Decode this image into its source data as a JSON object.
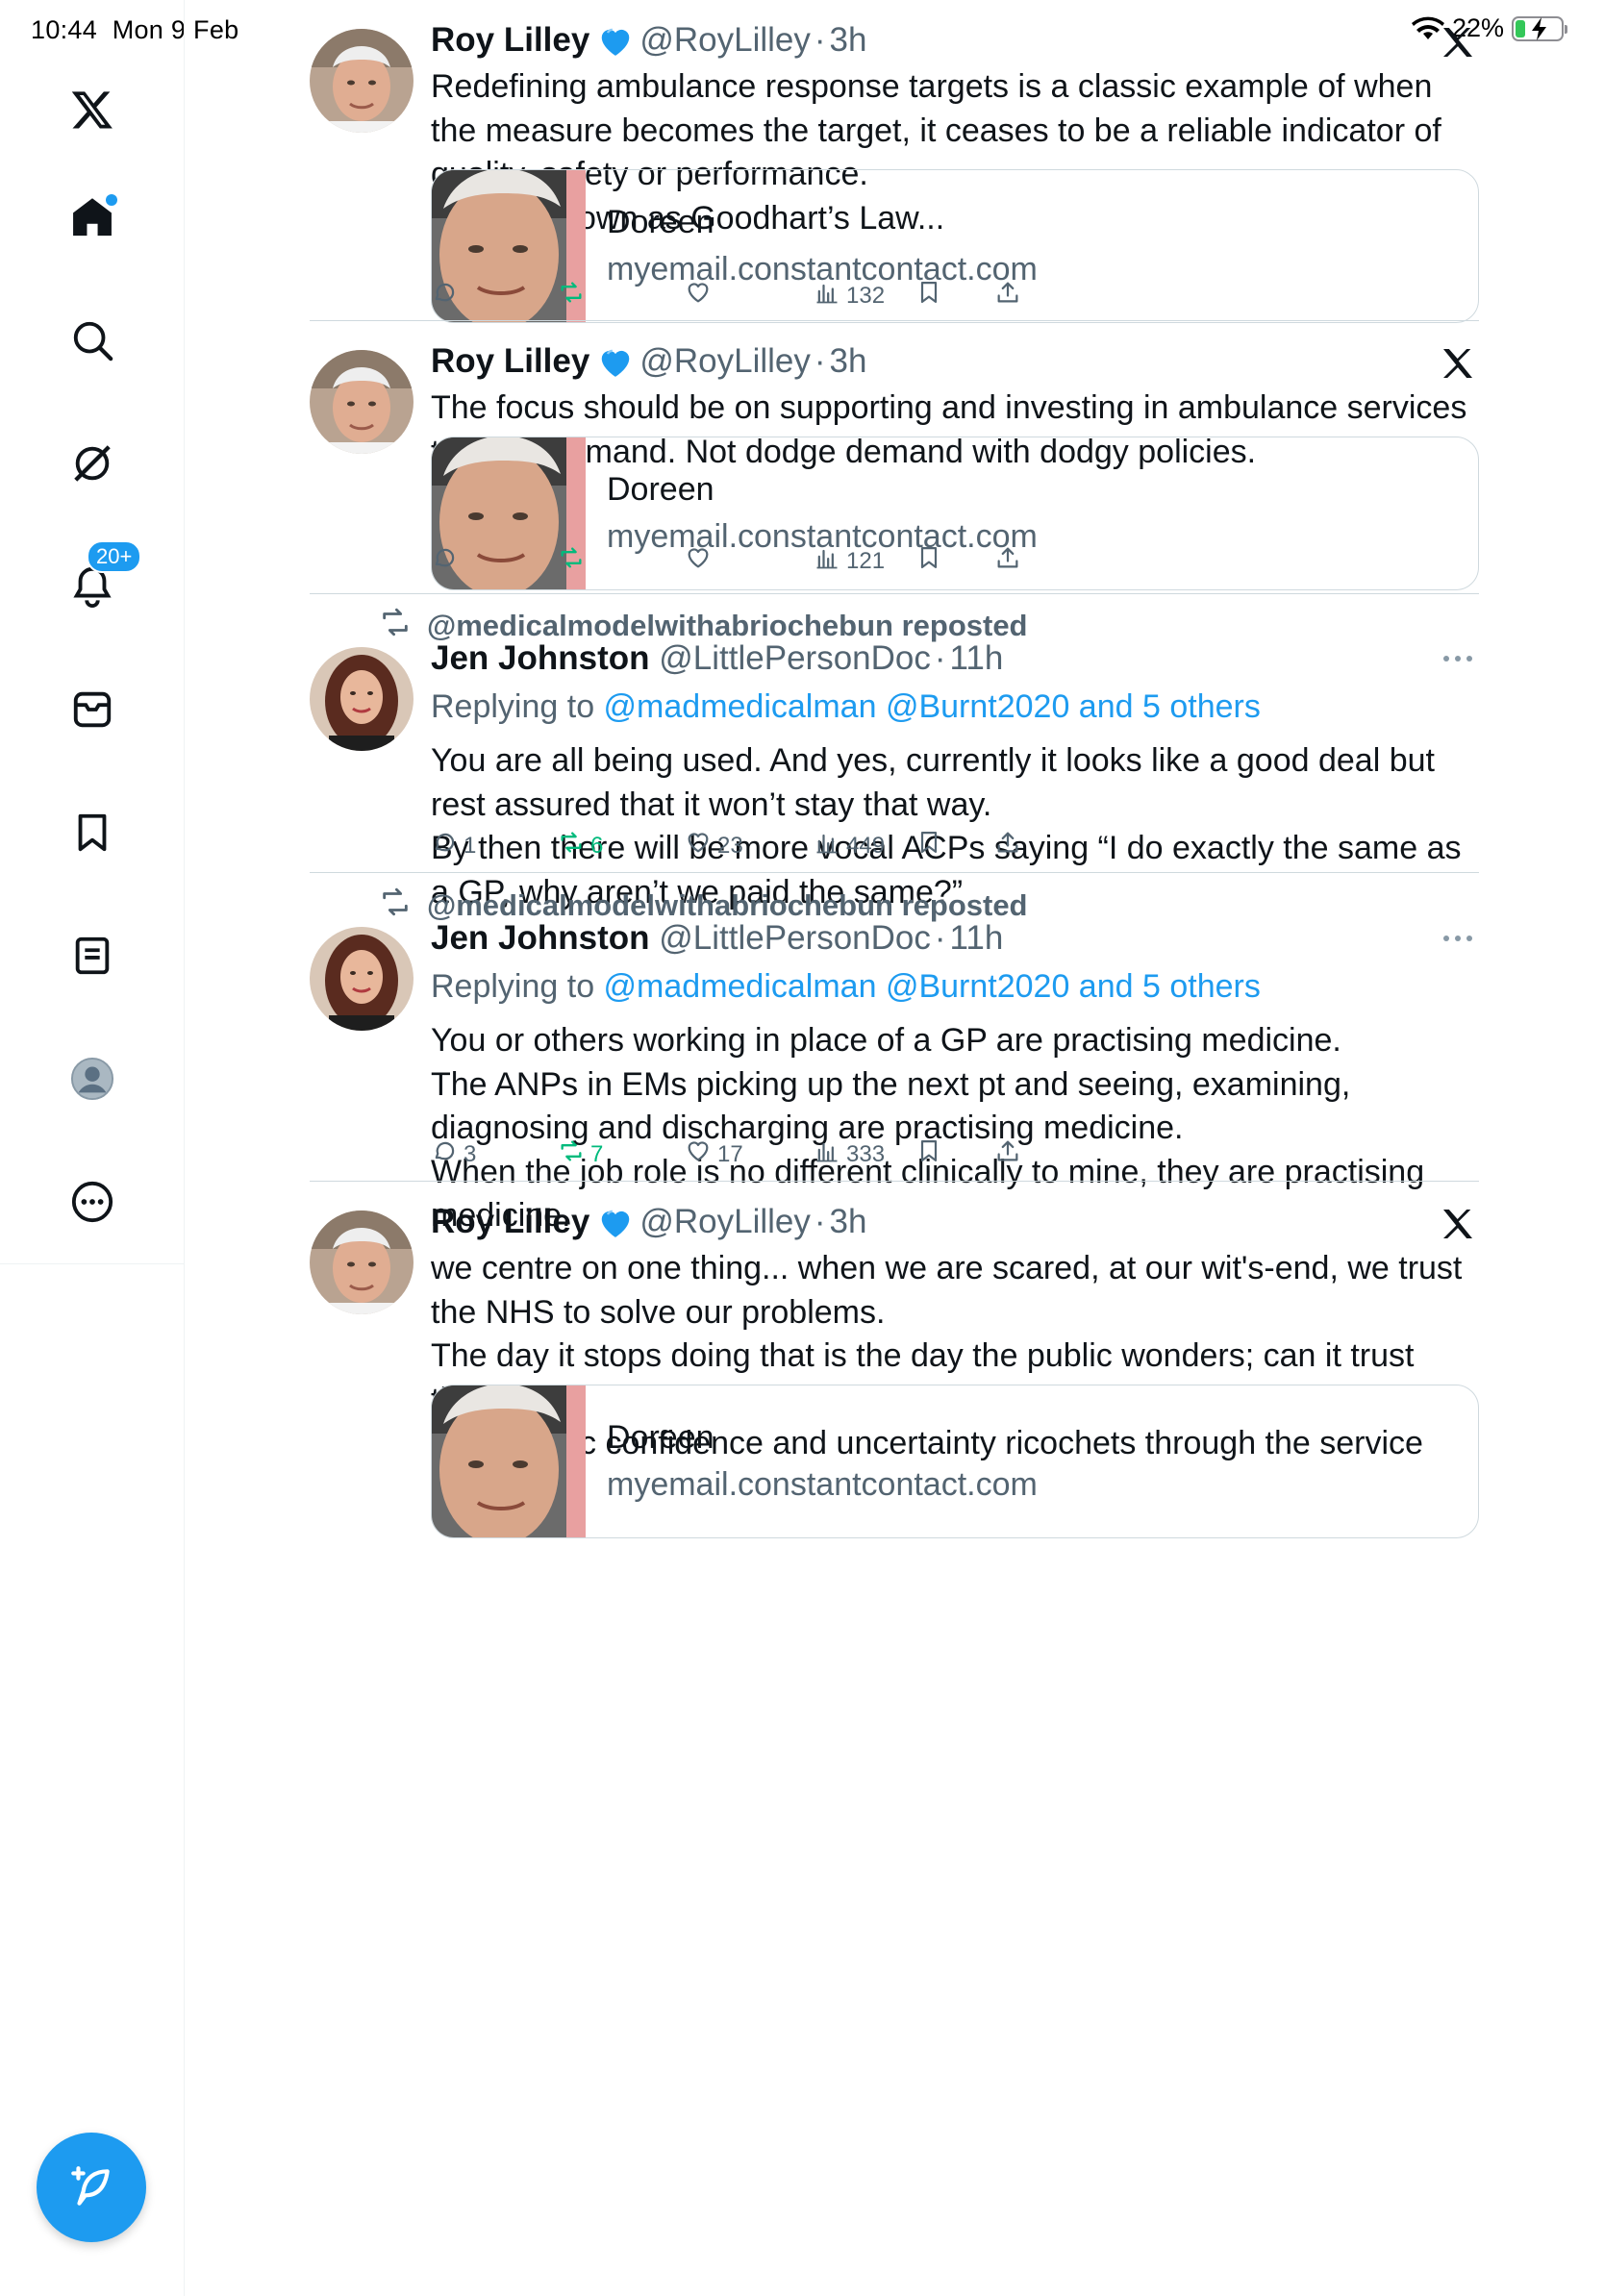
{
  "status_bar": {
    "time": "10:44",
    "date": "Mon 9 Feb",
    "battery_pct": "22%",
    "battery_level": 0.22
  },
  "sidebar": {
    "items": [
      {
        "name": "x-logo-icon"
      },
      {
        "name": "home-icon"
      },
      {
        "name": "search-icon"
      },
      {
        "name": "grok-icon"
      },
      {
        "name": "notifications-icon",
        "badge": "20+"
      },
      {
        "name": "messages-icon"
      },
      {
        "name": "bookmarks-icon"
      },
      {
        "name": "lists-icon"
      },
      {
        "name": "profile-icon"
      },
      {
        "name": "more-icon"
      }
    ],
    "compose_icon": "feather-plus-icon"
  },
  "colors": {
    "accent": "#1d9bf0",
    "retweet": "#00ba7c",
    "muted": "#536471"
  },
  "tweets": [
    {
      "name": "Roy Lilley",
      "handle": "@RoyLilley",
      "time": "3h",
      "text": "Redefining ambulance response targets is a classic example of when\nthe measure becomes the target, it ceases to be a reliable indicator of\nquality, safety or performance.\n This is known as Goodhart’s Law...",
      "card": {
        "title": "Doreen",
        "domain": "myemail.constantcontact.com"
      },
      "stats": {
        "replies": "",
        "reposts": "",
        "likes": "",
        "views": "132"
      }
    },
    {
      "name": "Roy Lilley",
      "handle": "@RoyLilley",
      "time": "3h",
      "text": "The focus should be on supporting and investing in ambulance services\nto meet demand. Not dodge demand with dodgy policies.",
      "card": {
        "title": "Doreen",
        "domain": "myemail.constantcontact.com"
      },
      "stats": {
        "replies": "",
        "reposts": "",
        "likes": "",
        "views": "121"
      }
    },
    {
      "reposted_by": "@medicalmodelwithabriochebun reposted",
      "name": "Jen Johnston",
      "handle": "@LittlePersonDoc",
      "time": "11h",
      "reply_prefix": "Replying to ",
      "reply_to": "@madmedicalman @Burnt2020 and 5 others",
      "text": "You are all being used. And yes, currently it looks like a good deal but\nrest assured that it won’t stay that way.\nBy then there will be more vocal ACPs saying “I do exactly the same as\na GP, why aren’t we paid the same?”",
      "stats": {
        "replies": "1",
        "reposts": "6",
        "likes": "23",
        "views": "449"
      }
    },
    {
      "reposted_by": "@medicalmodelwithabriochebun reposted",
      "name": "Jen Johnston",
      "handle": "@LittlePersonDoc",
      "time": "11h",
      "reply_prefix": "Replying to ",
      "reply_to": "@madmedicalman @Burnt2020 and 5 others",
      "text": "You or others working in place of a GP are practising medicine.\nThe ANPs in EMs picking up the next pt and seeing, examining,\ndiagnosing and discharging are practising medicine.\nWhen the job role is no different clinically to mine, they are practising\nmedicine.",
      "stats": {
        "replies": "3",
        "reposts": "7",
        "likes": "17",
        "views": "333"
      }
    },
    {
      "name": "Roy Lilley",
      "handle": "@RoyLilley",
      "time": "3h",
      "text": "we centre on one thing... when we are scared, at our wit's-end, we trust\nthe NHS to solve our problems.\nThe day it stops doing that is the day the public wonders; can it trust\nthe NHS.\nLose public confidence and uncertainty ricochets through the service",
      "card": {
        "title": "Doreen",
        "domain": "myemail.constantcontact.com"
      }
    }
  ]
}
